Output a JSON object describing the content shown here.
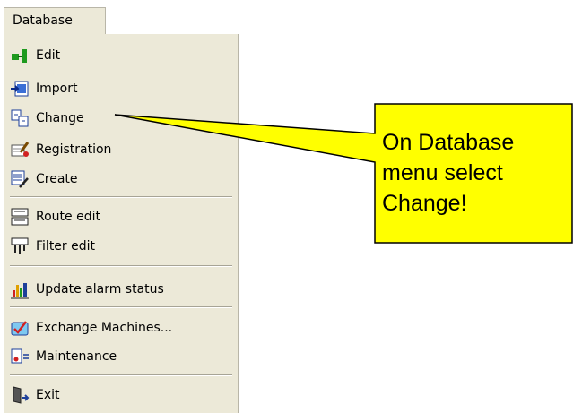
{
  "menu": {
    "title": "Database",
    "items": [
      {
        "label": "Edit",
        "icon": "edit-icon"
      },
      {
        "label": "Import",
        "icon": "import-icon"
      },
      {
        "label": "Change",
        "icon": "change-icon"
      },
      {
        "label": "Registration",
        "icon": "registration-icon"
      },
      {
        "label": "Create",
        "icon": "create-icon"
      },
      {
        "label": "Route edit",
        "icon": "route-edit-icon"
      },
      {
        "label": "Filter edit",
        "icon": "filter-edit-icon"
      },
      {
        "label": "Update alarm status",
        "icon": "alarm-status-icon"
      },
      {
        "label": "Exchange Machines...",
        "icon": "exchange-machines-icon"
      },
      {
        "label": "Maintenance",
        "icon": "maintenance-icon"
      },
      {
        "label": "Exit",
        "icon": "exit-icon"
      }
    ]
  },
  "callout": {
    "lines": [
      "On Database",
      "menu select",
      "Change!"
    ],
    "fill_color": "#ffff00"
  }
}
